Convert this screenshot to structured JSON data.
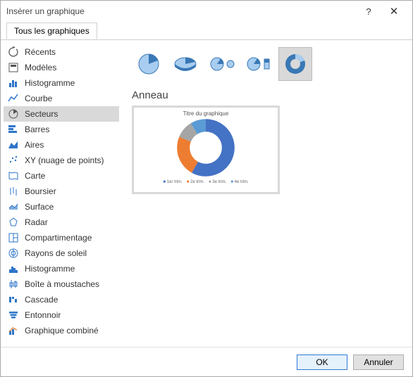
{
  "window": {
    "title": "Insérer un graphique",
    "help": "?",
    "close": "✕"
  },
  "tab": {
    "label": "Tous les graphiques"
  },
  "sidebar": {
    "items": [
      {
        "label": "Récents",
        "icon": "recent-icon"
      },
      {
        "label": "Modèles",
        "icon": "template-icon"
      },
      {
        "label": "Histogramme",
        "icon": "column-chart-icon"
      },
      {
        "label": "Courbe",
        "icon": "line-chart-icon"
      },
      {
        "label": "Secteurs",
        "icon": "pie-chart-icon",
        "selected": true
      },
      {
        "label": "Barres",
        "icon": "bar-chart-icon"
      },
      {
        "label": "Aires",
        "icon": "area-chart-icon"
      },
      {
        "label": "XY (nuage de points)",
        "icon": "scatter-chart-icon"
      },
      {
        "label": "Carte",
        "icon": "map-chart-icon"
      },
      {
        "label": "Boursier",
        "icon": "stock-chart-icon"
      },
      {
        "label": "Surface",
        "icon": "surface-chart-icon"
      },
      {
        "label": "Radar",
        "icon": "radar-chart-icon"
      },
      {
        "label": "Compartimentage",
        "icon": "treemap-chart-icon"
      },
      {
        "label": "Rayons de soleil",
        "icon": "sunburst-chart-icon"
      },
      {
        "label": "Histogramme",
        "icon": "histogram-chart-icon"
      },
      {
        "label": "Boîte à moustaches",
        "icon": "boxwhisker-chart-icon"
      },
      {
        "label": "Cascade",
        "icon": "waterfall-chart-icon"
      },
      {
        "label": "Entonnoir",
        "icon": "funnel-chart-icon"
      },
      {
        "label": "Graphique combiné",
        "icon": "combo-chart-icon"
      }
    ]
  },
  "subtypes": [
    {
      "name": "pie-2d"
    },
    {
      "name": "pie-3d"
    },
    {
      "name": "pie-of-pie"
    },
    {
      "name": "bar-of-pie"
    },
    {
      "name": "doughnut",
      "selected": true
    }
  ],
  "chart": {
    "heading": "Anneau",
    "preview_title": "Titre du graphique",
    "legend": [
      "1er trim.",
      "2e trim.",
      "3e trim.",
      "4e trim."
    ]
  },
  "chart_data": {
    "type": "pie",
    "title": "Titre du graphique",
    "categories": [
      "1er trim.",
      "2e trim.",
      "3e trim.",
      "4e trim."
    ],
    "values": [
      58,
      23,
      10,
      9
    ],
    "colors": [
      "#4472c4",
      "#ed7d31",
      "#a5a5a5",
      "#5b9bd5"
    ],
    "subtype": "doughnut"
  },
  "footer": {
    "ok": "OK",
    "cancel": "Annuler"
  }
}
